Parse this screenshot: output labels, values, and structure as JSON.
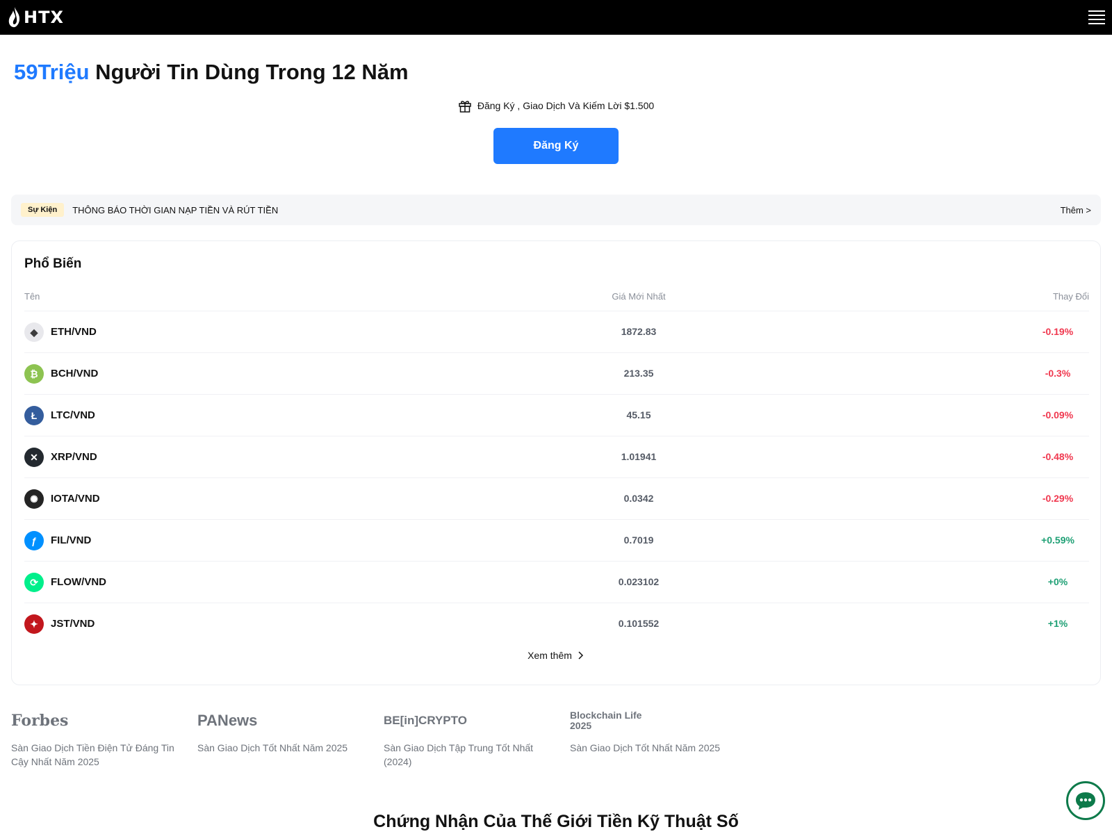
{
  "header": {
    "logo_text": "HTX",
    "menu_icon": "hamburger-menu-icon"
  },
  "hero": {
    "accent": "59Triệu",
    "title": " Người Tin Dùng Trong 12 Năm",
    "promo_icon": "gift-icon",
    "promo_text": "Đăng Ký , Giao Dịch Và Kiếm Lời $1.500",
    "signup_label": "Đăng Ký"
  },
  "announcement": {
    "badge": "Sự Kiện",
    "text": "THÔNG BÁO THỜI GIAN NẠP TIỀN VÀ RÚT TIỀN",
    "more": "Thêm >"
  },
  "popular": {
    "title": "Phổ Biến",
    "columns": {
      "name": "Tên",
      "price": "Giá Mới Nhất",
      "change": "Thay Đổi"
    },
    "rows": [
      {
        "pair": "ETH/VND",
        "price": "1872.83",
        "change": "-0.19%",
        "dir": "neg",
        "icon": "eth-icon",
        "color": "#e8e8ec"
      },
      {
        "pair": "BCH/VND",
        "price": "213.35",
        "change": "-0.3%",
        "dir": "neg",
        "icon": "bch-icon",
        "color": "#8dc351"
      },
      {
        "pair": "LTC/VND",
        "price": "45.15",
        "change": "-0.09%",
        "dir": "neg",
        "icon": "ltc-icon",
        "color": "#345d9d"
      },
      {
        "pair": "XRP/VND",
        "price": "1.01941",
        "change": "-0.48%",
        "dir": "neg",
        "icon": "xrp-icon",
        "color": "#23292f"
      },
      {
        "pair": "IOTA/VND",
        "price": "0.0342",
        "change": "-0.29%",
        "dir": "neg",
        "icon": "iota-icon",
        "color": "#242424"
      },
      {
        "pair": "FIL/VND",
        "price": "0.7019",
        "change": "+0.59%",
        "dir": "pos",
        "icon": "fil-icon",
        "color": "#0090ff"
      },
      {
        "pair": "FLOW/VND",
        "price": "0.023102",
        "change": "+0%",
        "dir": "pos",
        "icon": "flow-icon",
        "color": "#00ef8b"
      },
      {
        "pair": "JST/VND",
        "price": "0.101552",
        "change": "+1%",
        "dir": "pos",
        "icon": "jst-icon",
        "color": "#c2171d"
      }
    ],
    "view_more": "Xem thêm"
  },
  "press": [
    {
      "logo": "Forbes",
      "desc": "Sàn Giao Dịch Tiền Điện Tử Đáng Tin Cậy Nhất Năm 2025"
    },
    {
      "logo": "PANews",
      "desc": "Sàn Giao Dịch Tốt Nhất Năm 2025"
    },
    {
      "logo": "BE[in]CRYPTO",
      "desc": "Sàn Giao Dịch Tập Trung Tốt Nhất (2024)"
    },
    {
      "logo": "Blockchain Life 2025",
      "desc": "Sàn Giao Dịch Tốt Nhất Năm 2025"
    }
  ],
  "certification_title": "Chứng Nhận Của Thế Giới Tiền Kỹ Thuật Số",
  "chat_icon": "chat-bubble-icon"
}
